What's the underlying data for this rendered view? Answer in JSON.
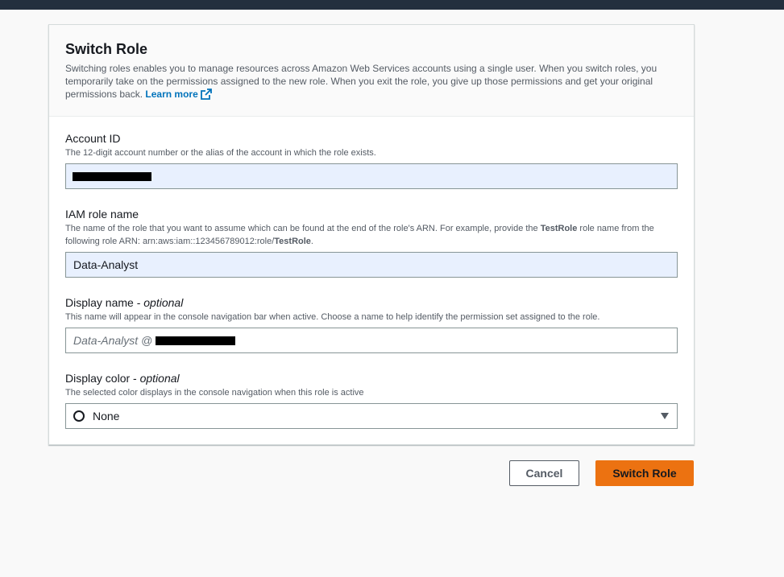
{
  "header": {
    "title": "Switch Role",
    "description": "Switching roles enables you to manage resources across Amazon Web Services accounts using a single user. When you switch roles, you temporarily take on the permissions assigned to the new role. When you exit the role, you give up those permissions and get your original permissions back.",
    "learn_more": "Learn more"
  },
  "account_id": {
    "label": "Account ID",
    "hint": "The 12-digit account number or the alias of the account in which the role exists."
  },
  "role_name": {
    "label": "IAM role name",
    "hint_prefix": "The name of the role that you want to assume which can be found at the end of the role's ARN. For example, provide the ",
    "hint_bold": "TestRole",
    "hint_middle": " role name from the following role ARN: arn:aws:iam::123456789012:role/",
    "hint_bold2": "TestRole",
    "hint_end": ".",
    "value": "Data-Analyst"
  },
  "display_name": {
    "label": "Display name - ",
    "label_optional": "optional",
    "hint": "This name will appear in the console navigation bar when active. Choose a name to help identify the permission set assigned to the role.",
    "placeholder": "Data-Analyst @ "
  },
  "display_color": {
    "label": "Display color - ",
    "label_optional": "optional",
    "hint": "The selected color displays in the console navigation when this role is active",
    "selected": "None"
  },
  "actions": {
    "cancel": "Cancel",
    "submit": "Switch Role"
  },
  "colors": {
    "primary": "#ec7211",
    "link": "#0073bb",
    "topbar": "#232f3e"
  }
}
